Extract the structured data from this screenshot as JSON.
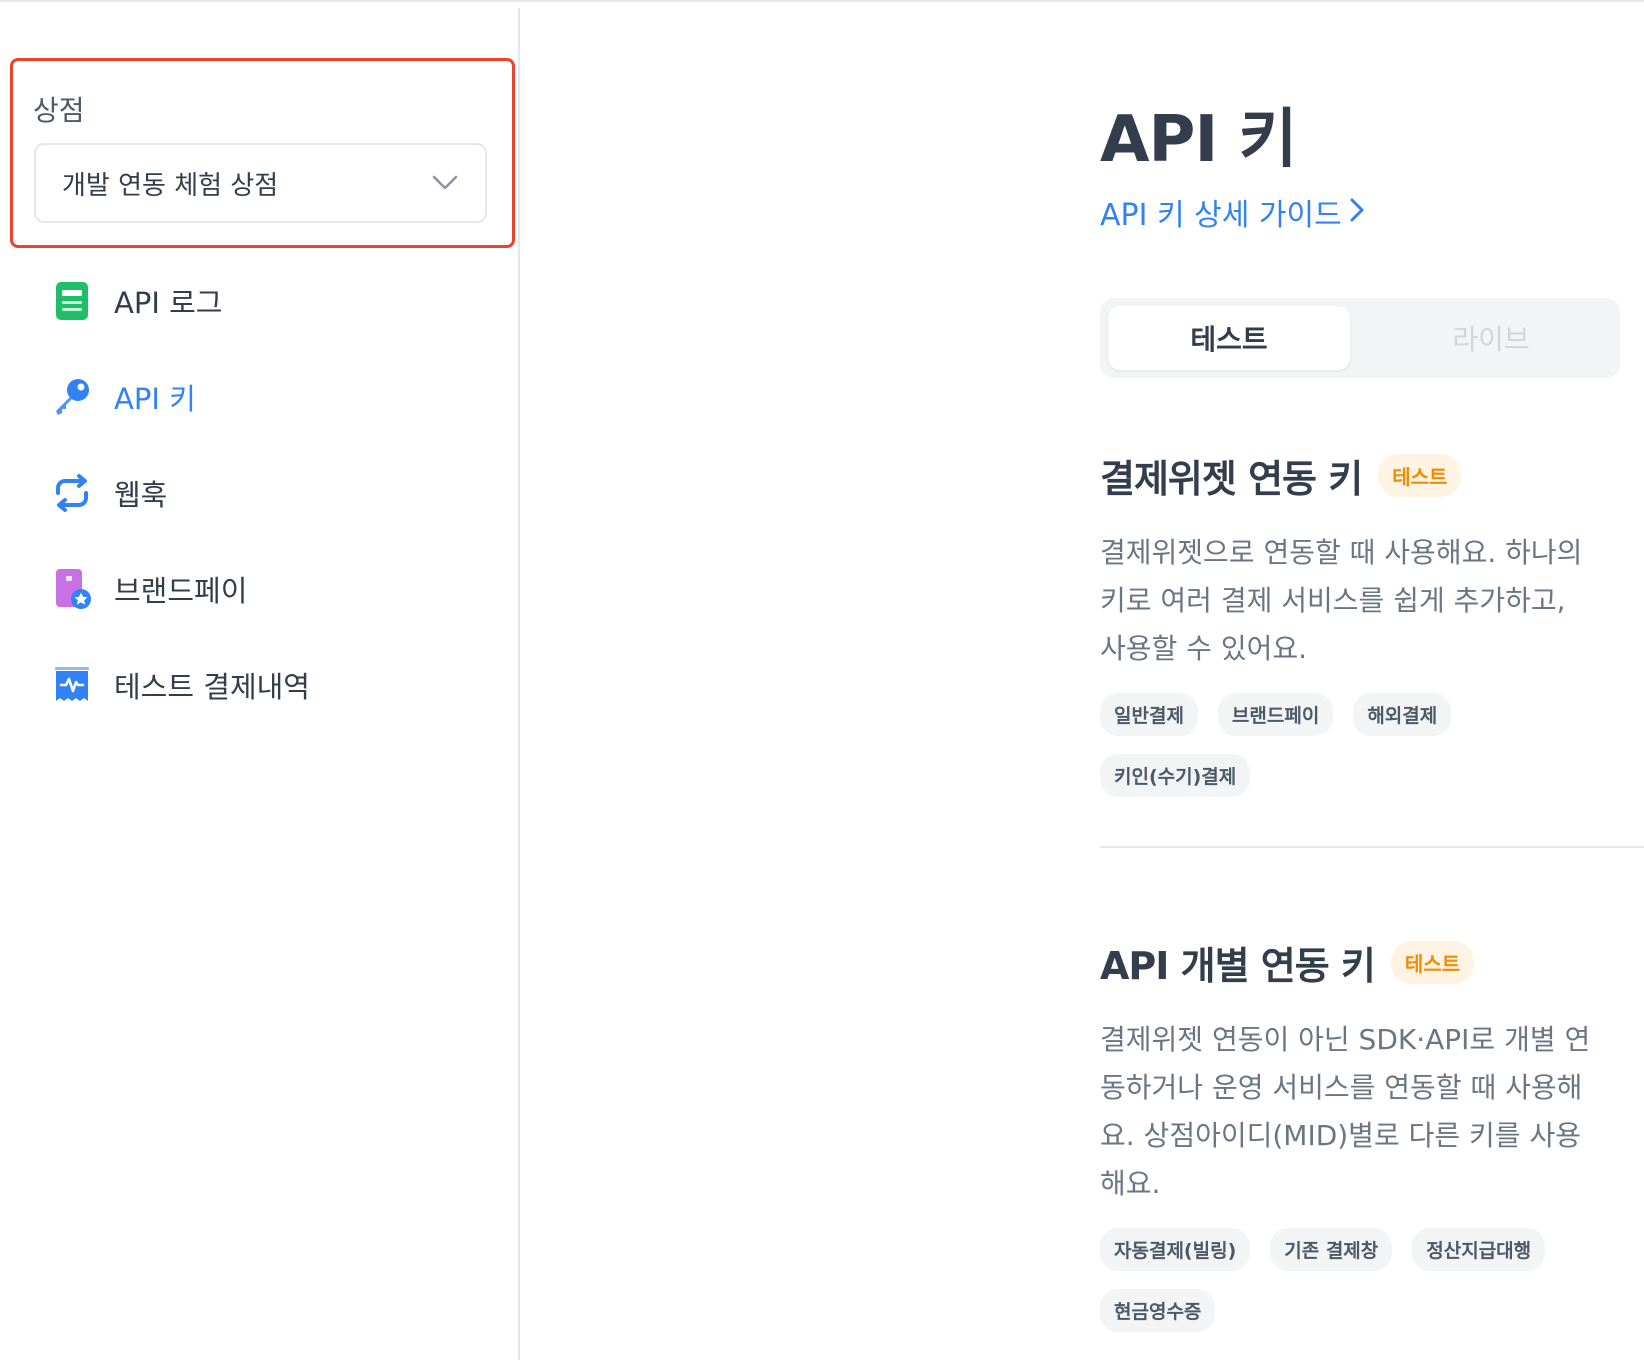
{
  "sidebar": {
    "store_label": "상점",
    "store_select_value": "개발 연동 체험 상점",
    "items": [
      {
        "label": "API 로그",
        "icon": "document-icon"
      },
      {
        "label": "API 키",
        "icon": "key-icon"
      },
      {
        "label": "웹훅",
        "icon": "refresh-icon"
      },
      {
        "label": "브랜드페이",
        "icon": "brandpay-icon"
      },
      {
        "label": "테스트 결제내역",
        "icon": "receipt-icon"
      }
    ],
    "active_item": "API 키"
  },
  "main": {
    "title": "API 키",
    "guide_link": "API 키 상세 가이드",
    "tabs": [
      {
        "label": "테스트",
        "active": true
      },
      {
        "label": "라이브",
        "active": false
      }
    ],
    "sections": [
      {
        "title": "결제위젯 연동 키",
        "badge": "테스트",
        "description": "결제위젯으로 연동할 때 사용해요. 하나의 키로 여러 결제 서비스를 쉽게 추가하고, 사용할 수 있어요.",
        "chips": [
          "일반결제",
          "브랜드페이",
          "해외결제",
          "키인(수기)결제"
        ]
      },
      {
        "title": "API 개별 연동 키",
        "badge": "테스트",
        "description": "결제위젯 연동이 아닌 SDK·API로 개별 연동하거나 운영 서비스를 연동할 때 사용해요. 상점아이디(MID)별로 다른 키를 사용해요.",
        "chips": [
          "자동결제(빌링)",
          "기존 결제창",
          "정산지급대행",
          "현금영수증"
        ]
      }
    ]
  },
  "colors": {
    "accent": "#3182f6",
    "highlight_border": "#e8442f",
    "badge_bg": "#fff3e4",
    "badge_text": "#f18b00"
  }
}
